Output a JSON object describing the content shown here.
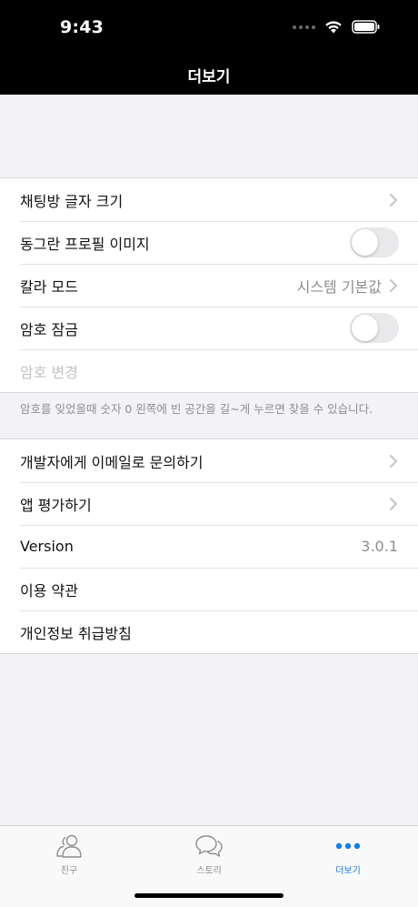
{
  "status_bar": {
    "time": "9:43"
  },
  "nav": {
    "title": "더보기"
  },
  "group1": {
    "items": [
      {
        "label": "채팅방 글자 크기"
      },
      {
        "label": "동그란 프로필 이미지",
        "toggle": false
      },
      {
        "label": "칼라 모드",
        "value": "시스템 기본값"
      },
      {
        "label": "암호 잠금",
        "toggle": false
      },
      {
        "label": "암호 변경",
        "disabled": true
      }
    ],
    "footnote": "암호를 잊었을때 숫자 0 왼쪽에 빈 공간을 길~게 누르면 찾을 수 있습니다."
  },
  "group2": {
    "items": [
      {
        "label": "개발자에게 이메일로 문의하기"
      },
      {
        "label": "앱 평가하기"
      },
      {
        "label": "Version",
        "value": "3.0.1"
      },
      {
        "label": "이용 약관"
      },
      {
        "label": "개인정보 취급방침"
      }
    ]
  },
  "tabbar": {
    "tabs": [
      {
        "label": "친구",
        "icon": "friends-icon"
      },
      {
        "label": "스토리",
        "icon": "chat-bubbles-icon"
      },
      {
        "label": "더보기",
        "icon": "more-dots-icon",
        "active": true
      }
    ]
  },
  "colors": {
    "accent": "#1a7ce8",
    "background": "#f2f2f7",
    "nav_bg": "#000000"
  }
}
